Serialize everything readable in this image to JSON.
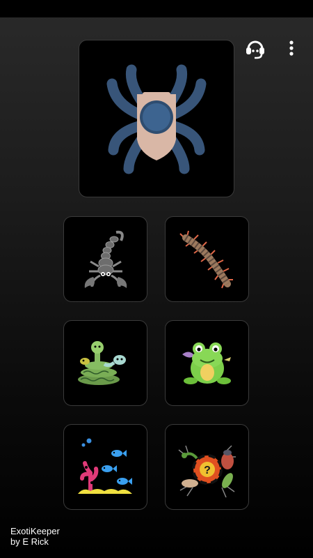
{
  "app": {
    "name": "ExotiKeeper",
    "author": "by E Rick"
  },
  "icons": {
    "support": "headset-icon",
    "menu": "more-vert-icon"
  },
  "tiles": [
    {
      "name": "tarantula-tile",
      "icon": "tarantula-icon"
    },
    {
      "name": "scorpion-tile",
      "icon": "scorpion-icon"
    },
    {
      "name": "centipede-tile",
      "icon": "centipede-icon"
    },
    {
      "name": "reptile-tile",
      "icon": "snake-lizard-icon"
    },
    {
      "name": "amphibian-tile",
      "icon": "frog-icon"
    },
    {
      "name": "aquatic-tile",
      "icon": "fish-coral-icon"
    },
    {
      "name": "other-invertebrates-tile",
      "icon": "insects-question-icon"
    }
  ],
  "colors": {
    "tile_background": "#000000",
    "tile_border": "#3a3a3a",
    "tarantula_legs": "#3b5a80",
    "tarantula_body": "#d9b7a6"
  }
}
